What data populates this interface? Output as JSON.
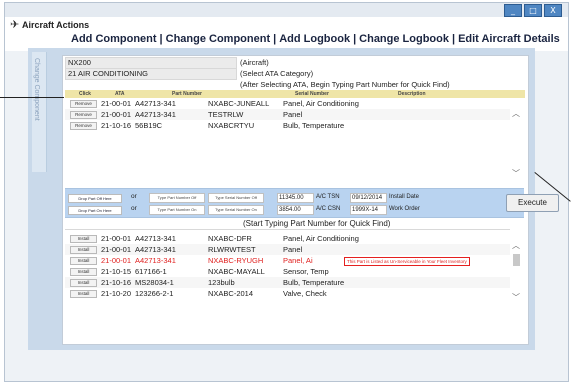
{
  "window": {
    "title": "Aircraft Actions",
    "buttons": [
      "_",
      "□",
      "X"
    ]
  },
  "nav": {
    "items": [
      "Add Component",
      "Change Component",
      "Add Logbook",
      "Change Logbook",
      "Edit Aircraft Details"
    ],
    "separator": "|"
  },
  "sidetab": {
    "label": "Change Component"
  },
  "aircraft": {
    "tail": "NX200",
    "tail_hint": "(Aircraft)",
    "ata": "21 AIR CONDITIONING",
    "ata_hint": "(Select ATA Category)",
    "partnum_hint": "(After Selecting ATA, Begin Typing Part Number for Quick Find)"
  },
  "table": {
    "headers": [
      "Click",
      "ATA",
      "Part Number",
      "Serial Number",
      "Description"
    ],
    "rows": [
      {
        "action": "Remove",
        "ata": "21-00-01",
        "part": "A42713-341",
        "serial": "NXABC-JUNEALL",
        "desc": "Panel, Air Conditioning"
      },
      {
        "action": "Remove",
        "ata": "21-00-01",
        "part": "A42713-341",
        "serial": "TESTRLW",
        "desc": "Panel"
      },
      {
        "action": "Remove",
        "ata": "21-10-16",
        "part": "56B19C",
        "serial": "NXABCRTYU",
        "desc": "Bulb, Temperature"
      }
    ]
  },
  "drop": {
    "off_label": "Drop Part Off Here",
    "on_label": "Drop Part On Here",
    "or": "or",
    "type_part_off": "Type Part Number Off",
    "type_serial_off": "Type Serial Number Off",
    "type_part_on": "Type Part Number On",
    "type_serial_on": "Type Serial Number On",
    "tsn_value": "11345.00",
    "tsn_label": "A/C TSN",
    "csn_value": "3854.00",
    "csn_label": "A/C CSN",
    "install_date": "09/12/2014",
    "install_date_label": "Install Date",
    "work_order": "1999X-14",
    "work_order_label": "Work Order",
    "execute": "Execute"
  },
  "search_hint": "(Start Typing Part Number for Quick Find)",
  "install_list": {
    "rows": [
      {
        "action": "Install",
        "ata": "21-00-01",
        "part": "A42713-341",
        "serial": "NXABC-DFR",
        "desc": "Panel, Air Conditioning",
        "unserviceable": false
      },
      {
        "action": "Install",
        "ata": "21-00-01",
        "part": "A42713-341",
        "serial": "RLWRWTEST",
        "desc": "Panel",
        "unserviceable": false
      },
      {
        "action": "Install",
        "ata": "21-00-01",
        "part": "A42713-341",
        "serial": "NXABC-RYUGH",
        "desc": "Panel, Ai",
        "unserviceable": true,
        "warning": "This Part is Listed as Un-Serviceable in Your Fleet Inventory"
      },
      {
        "action": "Install",
        "ata": "21-10-15",
        "part": "617166-1",
        "serial": "NXABC-MAYALL",
        "desc": "Sensor, Temp",
        "unserviceable": false
      },
      {
        "action": "Install",
        "ata": "21-10-16",
        "part": "MS28034-1",
        "serial": "123bulb",
        "desc": "Bulb, Temperature",
        "unserviceable": false
      },
      {
        "action": "Install",
        "ata": "21-10-20",
        "part": "123266-2-1",
        "serial": "NXABC-2014",
        "desc": "Valve, Check",
        "unserviceable": false
      }
    ]
  },
  "colors": {
    "accent": "#4f86c2",
    "header_row": "#efe5a7",
    "drop_bar": "#b9d3f0",
    "warning": "#e0201f"
  }
}
